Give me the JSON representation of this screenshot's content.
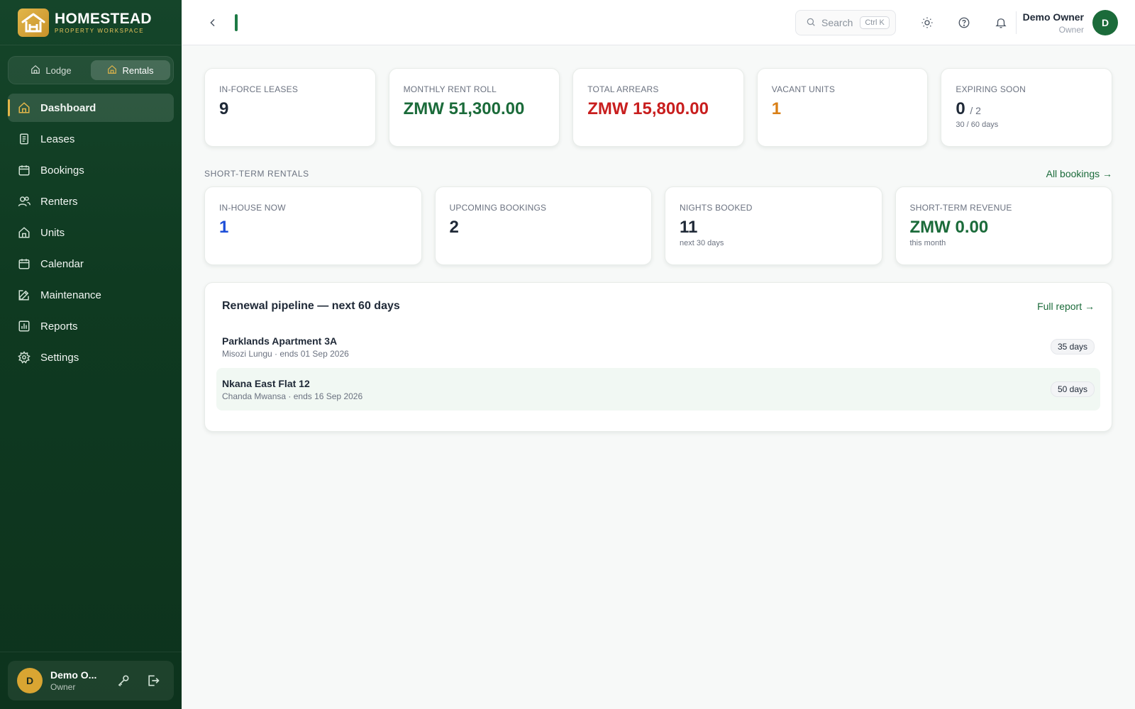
{
  "brand": {
    "name": "HOMESTEAD",
    "tagline": "PROPERTY WORKSPACE"
  },
  "switcher": [
    {
      "label": "Lodge",
      "icon": "home-icon",
      "active": false
    },
    {
      "label": "Rentals",
      "icon": "home-icon",
      "active": true
    }
  ],
  "nav": [
    {
      "label": "Dashboard",
      "icon": "home-icon",
      "active": true
    },
    {
      "label": "Leases",
      "icon": "document-icon",
      "active": false
    },
    {
      "label": "Bookings",
      "icon": "calendar-icon",
      "active": false
    },
    {
      "label": "Renters",
      "icon": "users-icon",
      "active": false
    },
    {
      "label": "Units",
      "icon": "building-icon",
      "active": false
    },
    {
      "label": "Calendar",
      "icon": "calendar-icon",
      "active": false
    },
    {
      "label": "Maintenance",
      "icon": "edit-icon",
      "active": false
    },
    {
      "label": "Reports",
      "icon": "chart-icon",
      "active": false
    },
    {
      "label": "Settings",
      "icon": "gear-icon",
      "active": false
    }
  ],
  "sidebar_user": {
    "initial": "D",
    "name": "Demo O...",
    "role": "Owner"
  },
  "topbar": {
    "search_placeholder": "Search",
    "search_shortcut": "Ctrl K",
    "user_name": "Demo Owner",
    "user_role": "Owner",
    "user_initial": "D"
  },
  "kpis": [
    {
      "label": "IN-FORCE LEASES",
      "value": "9",
      "color": "#1f2937"
    },
    {
      "label": "MONTHLY RENT ROLL",
      "value": "ZMW 51,300.00",
      "color": "#1b6b3a"
    },
    {
      "label": "TOTAL ARREARS",
      "value": "ZMW 15,800.00",
      "color": "#c81e1e"
    },
    {
      "label": "VACANT UNITS",
      "value": "1",
      "color": "#d97f16"
    },
    {
      "label": "EXPIRING SOON",
      "value": "0",
      "denominator": "/ 2",
      "sub": "30 / 60 days",
      "color": "#1f2937"
    }
  ],
  "short_term": {
    "title": "SHORT-TERM RENTALS",
    "link": "All bookings →",
    "cards": [
      {
        "label": "IN-HOUSE NOW",
        "value": "1",
        "sub": "",
        "color": "#1d4ed8"
      },
      {
        "label": "UPCOMING BOOKINGS",
        "value": "2",
        "sub": "",
        "color": "#1f2937"
      },
      {
        "label": "NIGHTS BOOKED",
        "value": "11",
        "sub": "next 30 days",
        "color": "#1f2937"
      },
      {
        "label": "SHORT-TERM REVENUE",
        "value": "ZMW 0.00",
        "sub": "this month",
        "color": "#1b6b3a"
      }
    ]
  },
  "pipeline": {
    "title": "Renewal pipeline — next 60 days",
    "link": "Full report →",
    "items": [
      {
        "name": "Parklands Apartment 3A",
        "meta": "Misozi Lungu · ends 01 Sep 2026",
        "days": "35 days"
      },
      {
        "name": "Nkana East Flat 12",
        "meta": "Chanda Mwansa · ends 16 Sep 2026",
        "days": "50 days"
      }
    ]
  }
}
